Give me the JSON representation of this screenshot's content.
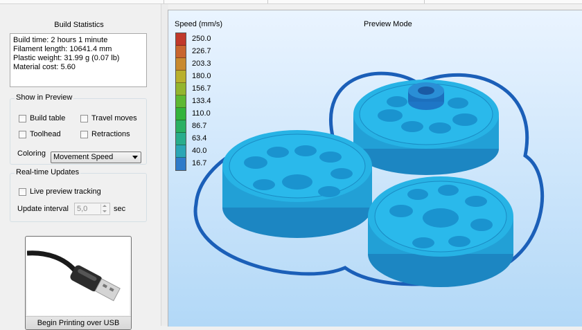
{
  "build_statistics": {
    "title": "Build Statistics",
    "lines": [
      "Build time: 2 hours 1 minute",
      "Filament length: 10641.4 mm",
      "Plastic weight: 31.99 g (0.07 lb)",
      "Material cost: 5.60"
    ]
  },
  "show_in_preview": {
    "title": "Show in Preview",
    "build_table": "Build table",
    "travel_moves": "Travel moves",
    "toolhead": "Toolhead",
    "retractions": "Retractions",
    "coloring_label": "Coloring",
    "coloring_value": "Movement Speed"
  },
  "realtime": {
    "title": "Real-time Updates",
    "live_preview": "Live preview tracking",
    "interval_label": "Update interval",
    "interval_value": "5,0",
    "interval_unit": "sec"
  },
  "usb_button": {
    "label": "Begin Printing over USB"
  },
  "viewport": {
    "mode": "Preview Mode",
    "legend_title": "Speed (mm/s)",
    "legend": [
      {
        "value": "250.0",
        "color": "#c0392b"
      },
      {
        "value": "226.7",
        "color": "#c8652f"
      },
      {
        "value": "203.3",
        "color": "#c88a30"
      },
      {
        "value": "180.0",
        "color": "#b8b02e"
      },
      {
        "value": "156.7",
        "color": "#93b52f"
      },
      {
        "value": "133.4",
        "color": "#5db833"
      },
      {
        "value": "110.0",
        "color": "#33b33c"
      },
      {
        "value": "86.7",
        "color": "#2ab063"
      },
      {
        "value": "63.4",
        "color": "#28ad8c"
      },
      {
        "value": "40.0",
        "color": "#2aa6b5"
      },
      {
        "value": "16.7",
        "color": "#2f7bc9"
      }
    ]
  }
}
